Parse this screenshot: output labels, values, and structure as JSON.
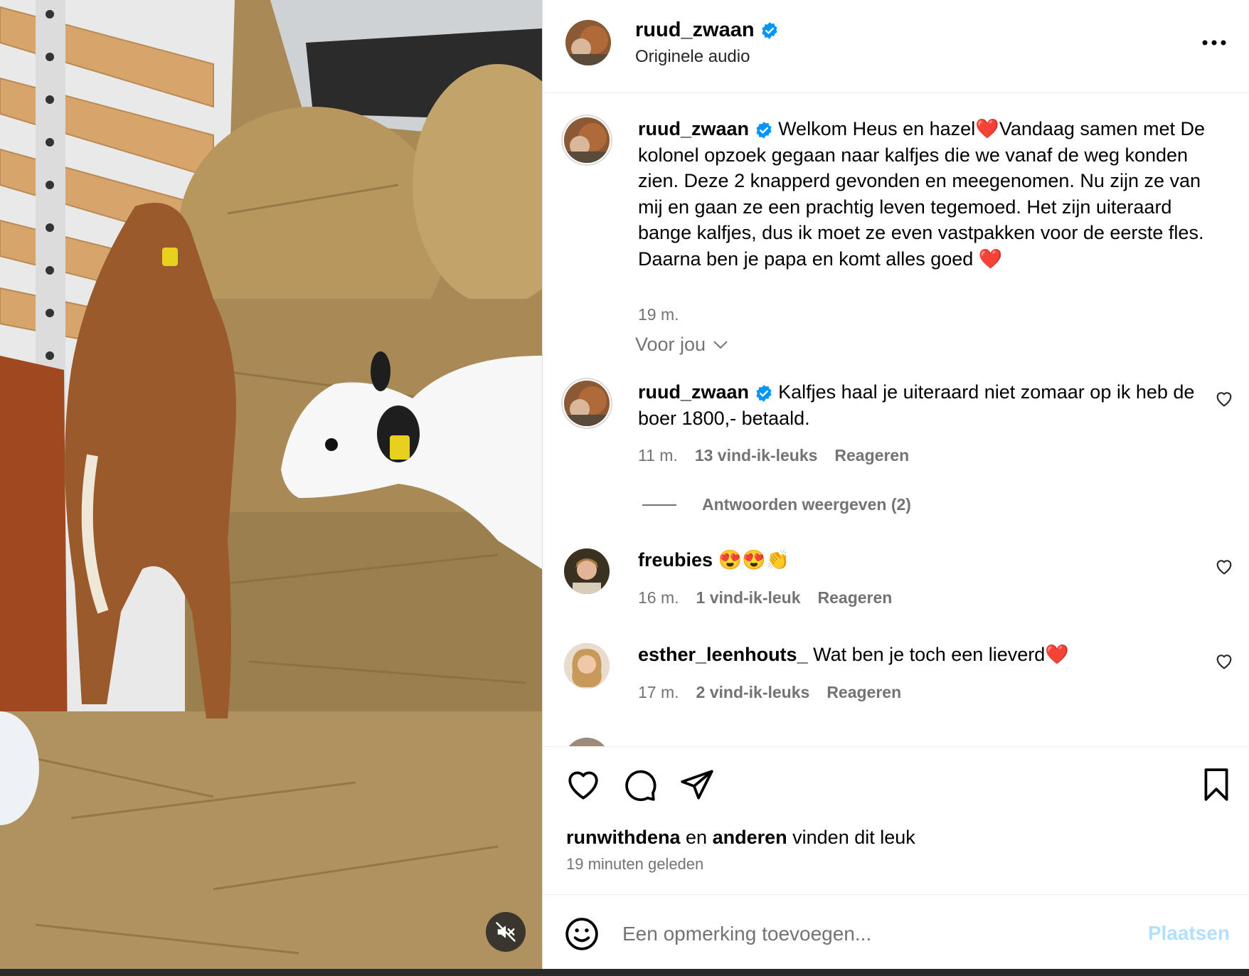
{
  "header": {
    "username": "ruud_zwaan",
    "subtitle": "Originele audio"
  },
  "caption": {
    "username": "ruud_zwaan",
    "text": "Welkom Heus en hazel❤️Vandaag samen met De kolonel opzoek gegaan naar kalfjes die we vanaf de weg konden zien. Deze 2 knapperd gevonden en meegenomen. Nu zijn ze van mij en gaan ze een prachtig leven tegemoed. Het zijn uiteraard bange kalfjes, dus ik moet ze even vastpakken voor de eerste fles. Daarna ben je papa en komt alles goed ❤️",
    "time": "19 m."
  },
  "sort_label": "Voor jou",
  "comments": [
    {
      "username": "ruud_zwaan",
      "text": "Kalfjes haal je uiteraard niet zomaar op ik heb de boer 1800,- betaald.",
      "time": "11 m.",
      "likes": "13 vind-ik-leuks",
      "reply": "Reageren",
      "view_replies": "Antwoorden weergeven (2)"
    },
    {
      "username": "freubies",
      "text": "😍😍👏",
      "time": "16 m.",
      "likes": "1 vind-ik-leuk",
      "reply": "Reageren"
    },
    {
      "username": "esther_leenhouts_",
      "text": "Wat ben je toch een lieverd❤️",
      "time": "17 m.",
      "likes": "2 vind-ik-leuks",
      "reply": "Reageren"
    }
  ],
  "likes_line": {
    "user": "runwithdena",
    "middle": "en",
    "others": "anderen",
    "suffix": "vinden dit leuk"
  },
  "posted_time": "19 minuten geleden",
  "add_comment": {
    "placeholder": "Een opmerking toevoegen...",
    "post_label": "Plaatsen"
  },
  "colors": {
    "verified": "#0095f6",
    "muted_text": "#737373",
    "post_button_disabled": "#b2dffc",
    "heart_emoji": "#e0245e"
  }
}
